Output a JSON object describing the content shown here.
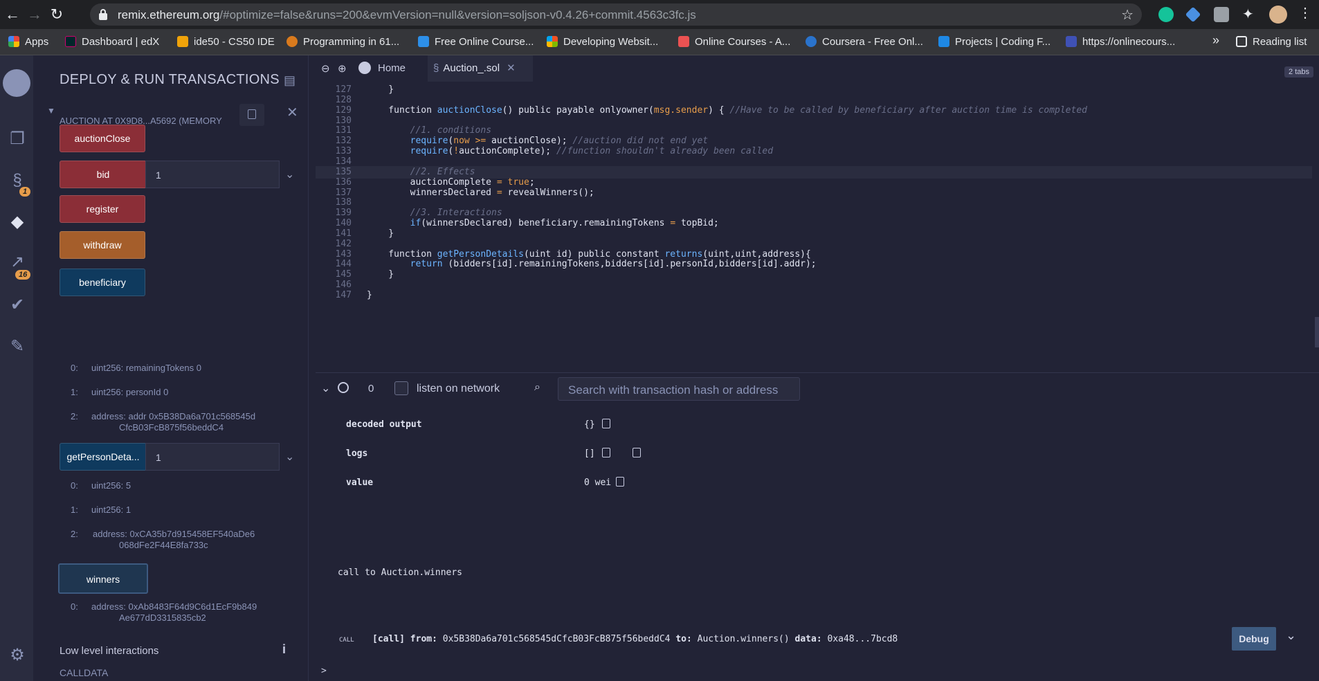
{
  "browser": {
    "url_host": "remix.ethereum.org",
    "url_path": "/#optimize=false&runs=200&evmVersion=null&version=soljson-v0.4.26+commit.4563c3fc.js",
    "bookmarks": [
      {
        "label": "Apps",
        "color": "#e8453c"
      },
      {
        "label": "Dashboard | edX",
        "color": "#02262b"
      },
      {
        "label": "ide50 - CS50 IDE",
        "color": "#f0a30a"
      },
      {
        "label": "Programming in 61...",
        "color": "#d97a1d"
      },
      {
        "label": "Free Online Course...",
        "color": "#2d8fe8"
      },
      {
        "label": "Developing Websit...",
        "color": "#f25022"
      },
      {
        "label": "Online Courses - A...",
        "color": "#ec5252"
      },
      {
        "label": "Coursera - Free Onl...",
        "color": "#2a73cc"
      },
      {
        "label": "Projects | Coding F...",
        "color": "#1e88e5"
      },
      {
        "label": "https://onlinecours...",
        "color": "#3f51b5"
      }
    ],
    "more": "»",
    "reading_list": "Reading list"
  },
  "icon_panel": {
    "badges": [
      "1",
      "16"
    ]
  },
  "side_panel": {
    "title": "DEPLOY & RUN TRANSACTIONS",
    "instance_title": "AUCTION AT 0X9D8...A5692 (MEMORY",
    "functions": {
      "auctionClose": "auctionClose",
      "bid": "bid",
      "bid_value": "1",
      "register": "register",
      "withdraw": "withdraw",
      "beneficiary": "beneficiary",
      "getPersonDetails": "getPersonDeta...",
      "getPersonDetails_value": "1",
      "winners": "winners"
    },
    "beneficiary_outputs": [
      {
        "idx": "0:",
        "val": "uint256: remainingTokens 0"
      },
      {
        "idx": "1:",
        "val": "uint256: personId 0"
      },
      {
        "idx": "2:",
        "val": "address: addr 0x5B38Da6a701c568545d",
        "val2": "CfcB03FcB875f56beddC4"
      }
    ],
    "person_outputs": [
      {
        "idx": "0:",
        "val": "uint256: 5"
      },
      {
        "idx": "1:",
        "val": "uint256: 1"
      },
      {
        "idx": "2:",
        "val": "address: 0xCA35b7d915458EF540aDe6",
        "val2": "068dFe2F44E8fa733c"
      }
    ],
    "winners_outputs": [
      {
        "idx": "0:",
        "val": "address: 0xAb8483F64d9C6d1EcF9b849",
        "val2": "Ae677dD3315835cb2"
      }
    ],
    "low_level": "Low level interactions",
    "calldata": "CALLDATA"
  },
  "editor": {
    "tabs": [
      {
        "label": "Home"
      },
      {
        "label": "Auction_.sol"
      }
    ],
    "tabs_count": "2 tabs",
    "lines": [
      {
        "n": "127",
        "html": "    }"
      },
      {
        "n": "128",
        "html": ""
      },
      {
        "n": "129",
        "html": "    function <span class='fn'>auctionClose</span>() public payable onlyowner(<span class='or'>msg.sender</span>) { <span class='cm'>//Have to be called by beneficiary after auction time is completed</span>"
      },
      {
        "n": "130",
        "html": ""
      },
      {
        "n": "131",
        "html": "        <span class='cm'>//1. conditions</span>"
      },
      {
        "n": "132",
        "html": "        <span class='kw'>require</span>(<span class='or'>now</span> <span class='or'>&gt;=</span> auctionClose); <span class='cm'>//auction did not end yet</span>"
      },
      {
        "n": "133",
        "html": "        <span class='kw'>require</span>(<span class='or'>!</span>auctionComplete); <span class='cm'>//function shouldn't already been called</span>"
      },
      {
        "n": "134",
        "html": ""
      },
      {
        "n": "135",
        "html": "        <span class='cm'>//2. Effects</span>"
      },
      {
        "n": "136",
        "html": "        auctionComplete <span class='or'>=</span> <span class='or'>true</span>;"
      },
      {
        "n": "137",
        "html": "        winnersDeclared <span class='or'>=</span> revealWinners();"
      },
      {
        "n": "138",
        "html": ""
      },
      {
        "n": "139",
        "html": "        <span class='cm'>//3. Interactions</span>"
      },
      {
        "n": "140",
        "html": "        <span class='kw'>if</span>(winnersDeclared) beneficiary.remainingTokens <span class='or'>=</span> topBid;"
      },
      {
        "n": "141",
        "html": "    }"
      },
      {
        "n": "142",
        "html": ""
      },
      {
        "n": "143",
        "html": "    function <span class='fn'>getPersonDetails</span>(uint id) public constant <span class='kw'>returns</span>(uint,uint,address){"
      },
      {
        "n": "144",
        "html": "        <span class='kw'>return</span> (bidders[id].remainingTokens,bidders[id].personId,bidders[id].addr);"
      },
      {
        "n": "145",
        "html": "    }"
      },
      {
        "n": "146",
        "html": ""
      },
      {
        "n": "147",
        "html": "}"
      }
    ]
  },
  "terminal": {
    "pending_count": "0",
    "listen_label": "listen on network",
    "search_placeholder": "Search with transaction hash or address",
    "decoded_output_key": "decoded output",
    "decoded_output_val": "{}",
    "logs_key": "logs",
    "logs_val": "[]",
    "value_key": "value",
    "value_val": "0 wei",
    "call_msg": "call to Auction.winners",
    "call_tag": "CALL",
    "call_line_pre": "[call]",
    "from_label": "from:",
    "from_val": "0x5B38Da6a701c568545dCfcB03FcB875f56beddC4",
    "to_label": "to:",
    "to_val": "Auction.winners()",
    "data_label": "data:",
    "data_val": "0xa48...7bcd8",
    "debug_label": "Debug",
    "prompt": ">"
  }
}
